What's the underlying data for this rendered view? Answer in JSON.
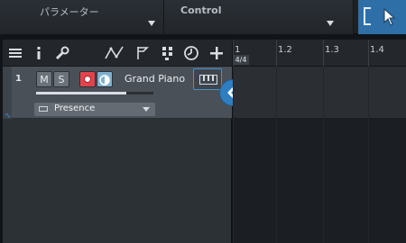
{
  "topbar": {
    "parameters_label": "パラメーター",
    "control_label": "Control"
  },
  "toolbar": {
    "icons": [
      "list-icon",
      "info-icon",
      "wrench-icon",
      "automation-icon",
      "flag-icon",
      "grid-icon",
      "clock-icon",
      "add-icon"
    ]
  },
  "track": {
    "number": "1",
    "mute_label": "M",
    "solo_label": "S",
    "name": "Grand Piano",
    "preset": "Presence",
    "volume_level": 0.77,
    "automation_symbol": "∿"
  },
  "timeline": {
    "time_signature": "4/4",
    "bars": [
      "1",
      "1.2",
      "1.3",
      "1.4"
    ]
  },
  "colors": {
    "accent": "#2f7ec1",
    "record": "#e0444c",
    "monitor": "#7fb1ce"
  }
}
